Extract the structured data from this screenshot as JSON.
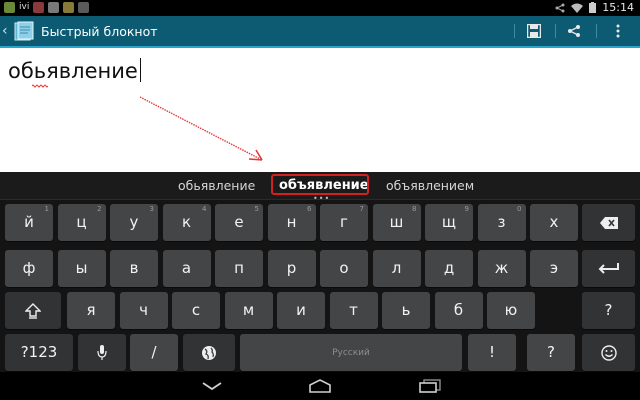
{
  "status_bar": {
    "left_icons": [
      "android-icon",
      "ivi-icon",
      "app-icon",
      "image-icon",
      "shopping-icon",
      "mail-icon"
    ],
    "ivi_text": "ivi",
    "time": "15:14"
  },
  "action_bar": {
    "title": "Быстрый блокнот",
    "accent": "#0d5a73",
    "highlight": "#2aa4cb"
  },
  "editor": {
    "text": "обьявление"
  },
  "suggestions": {
    "left": "обьявление",
    "center": "объявление",
    "right": "объявлением",
    "highlight_color": "#d52020"
  },
  "keyboard": {
    "row1": [
      {
        "label": "й",
        "hint": "1"
      },
      {
        "label": "ц",
        "hint": "2"
      },
      {
        "label": "у",
        "hint": "3"
      },
      {
        "label": "к",
        "hint": "4"
      },
      {
        "label": "е",
        "hint": "5"
      },
      {
        "label": "н",
        "hint": "6"
      },
      {
        "label": "г",
        "hint": "7"
      },
      {
        "label": "ш",
        "hint": "8"
      },
      {
        "label": "щ",
        "hint": "9"
      },
      {
        "label": "з",
        "hint": "0"
      },
      {
        "label": "х",
        "hint": ""
      }
    ],
    "row2": [
      "ф",
      "ы",
      "в",
      "а",
      "п",
      "р",
      "о",
      "л",
      "д",
      "ж",
      "э"
    ],
    "row3": [
      "я",
      "ч",
      "с",
      "м",
      "и",
      "т",
      "ь",
      "б",
      "ю"
    ],
    "symbols_label": "?123",
    "slash_label": "/",
    "space_label": "Русский",
    "exclaim_label": "!",
    "question_label": "?",
    "row4_hint_exclaim": "",
    "row3_comma": ","
  },
  "nav_bar": {
    "buttons": [
      "back",
      "home",
      "recent-apps"
    ]
  }
}
